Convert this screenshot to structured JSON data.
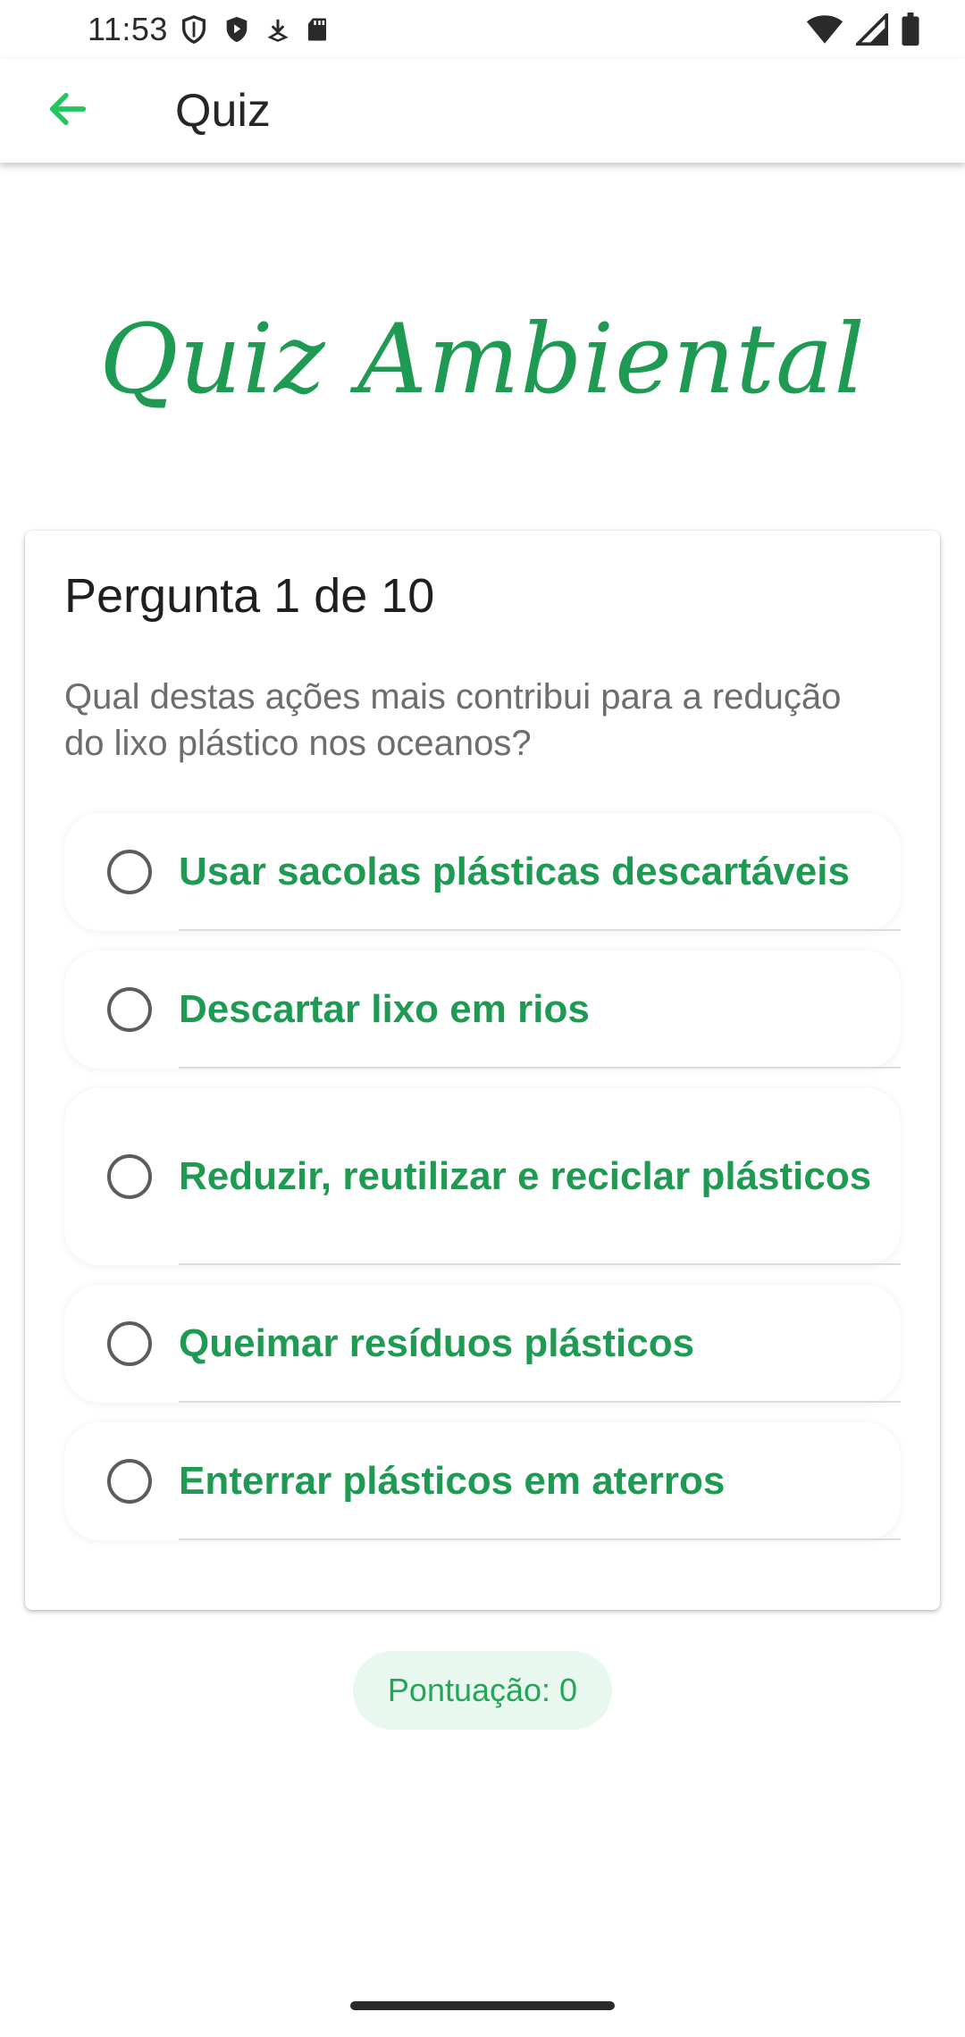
{
  "status_bar": {
    "time": "11:53",
    "icons_left": [
      "shield-outline-icon",
      "shield-play-icon",
      "download-icon",
      "sd-card-icon"
    ],
    "icons_right": [
      "wifi-icon",
      "signal-icon",
      "battery-icon"
    ]
  },
  "app_bar": {
    "title": "Quiz",
    "back_icon": "arrow-back-icon",
    "accent_color": "#22c55e"
  },
  "logo": {
    "text": "Quiz Ambiental",
    "color": "#1f9a52"
  },
  "question": {
    "counter": "Pergunta 1 de 10",
    "text": "Qual destas ações mais contribui para a redução do lixo plástico nos oceanos?",
    "options": [
      {
        "label": "Usar sacolas plásticas descartáveis",
        "selected": false
      },
      {
        "label": "Descartar lixo em rios",
        "selected": false
      },
      {
        "label": "Reduzir, reutilizar e reciclar plásticos",
        "selected": false
      },
      {
        "label": "Queimar resíduos plásticos",
        "selected": false
      },
      {
        "label": "Enterrar plásticos em aterros",
        "selected": false
      }
    ]
  },
  "score": {
    "label": "Pontuação: 0",
    "value": 0
  },
  "colors": {
    "primary_green": "#1f9a52",
    "score_background": "#e9f8ee"
  }
}
